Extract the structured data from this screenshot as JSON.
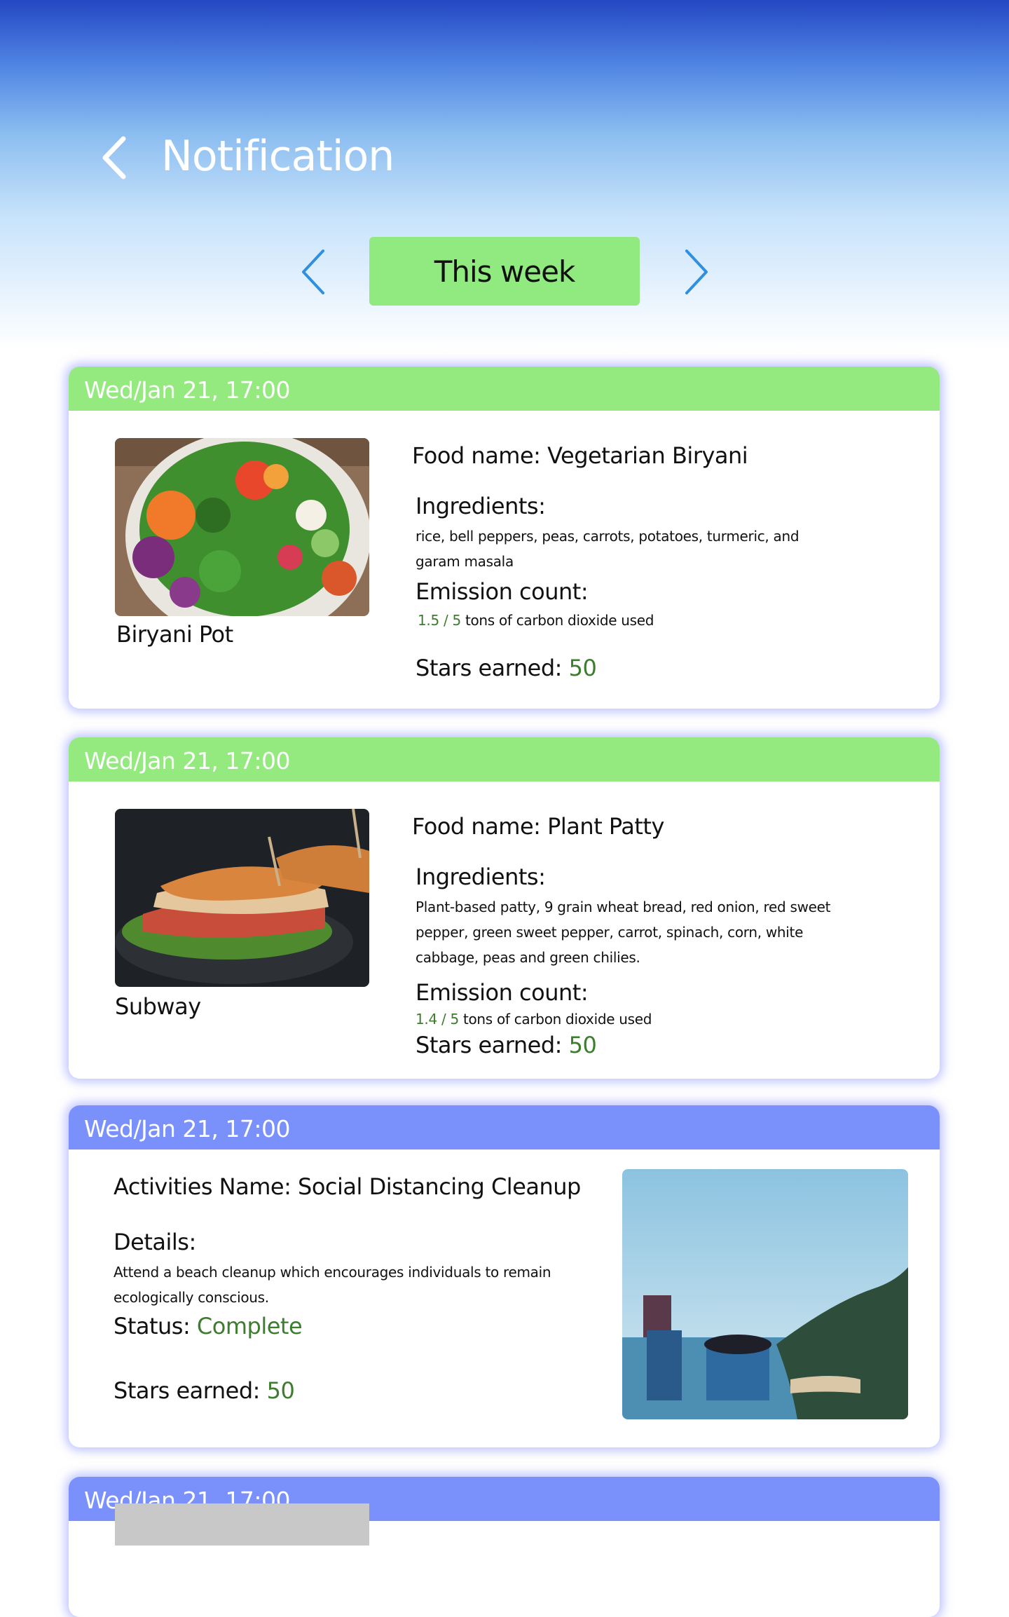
{
  "header": {
    "title": "Notification"
  },
  "week_selector": {
    "label": "This week"
  },
  "cards": [
    {
      "timestamp": "Wed/Jan 21, 17:00",
      "image_caption": "Biryani Pot",
      "name_label": "Food name: ",
      "name": "Vegetarian Biryani",
      "ingredients_label": "Ingredients:",
      "ingredients": "rice, bell peppers, peas, carrots, potatoes, turmeric, and garam masala",
      "emission_label": "Emission count:",
      "emission_value": "1.5 / 5",
      "emission_unit": "tons of carbon dioxide used",
      "stars_label": "Stars earned: ",
      "stars": "50"
    },
    {
      "timestamp": "Wed/Jan 21, 17:00",
      "image_caption": "Subway",
      "name_label": "Food name: ",
      "name": "Plant Patty",
      "ingredients_label": "Ingredients:",
      "ingredients": "Plant-based patty, 9 grain wheat bread, red onion, red sweet pepper, green sweet pepper, carrot, spinach, corn, white cabbage, peas and green chilies.",
      "emission_label": "Emission count:",
      "emission_value": "1.4 / 5",
      "emission_unit": "tons of carbon dioxide used",
      "stars_label": "Stars earned: ",
      "stars": "50"
    },
    {
      "timestamp": "Wed/Jan 21, 17:00",
      "name_label": "Activities Name: ",
      "name": "Social Distancing Cleanup",
      "details_label": "Details:",
      "details": "Attend a beach cleanup which encourages individuals to remain ecologically conscious.",
      "status_label": "Status: ",
      "status": "Complete",
      "stars_label": "Stars earned: ",
      "stars": "50"
    },
    {
      "timestamp": "Wed/Jan 21, 17:00"
    }
  ],
  "colors": {
    "food_header": "#94e97f",
    "activity_header": "#7a91fb",
    "week_pill": "#90ea80",
    "accent_value": "#3d7d2e",
    "nav_arrow": "#2f8fe0"
  },
  "icons": {
    "back": "chevron-left-icon",
    "prev_week": "chevron-left-icon",
    "next_week": "chevron-right-icon"
  }
}
